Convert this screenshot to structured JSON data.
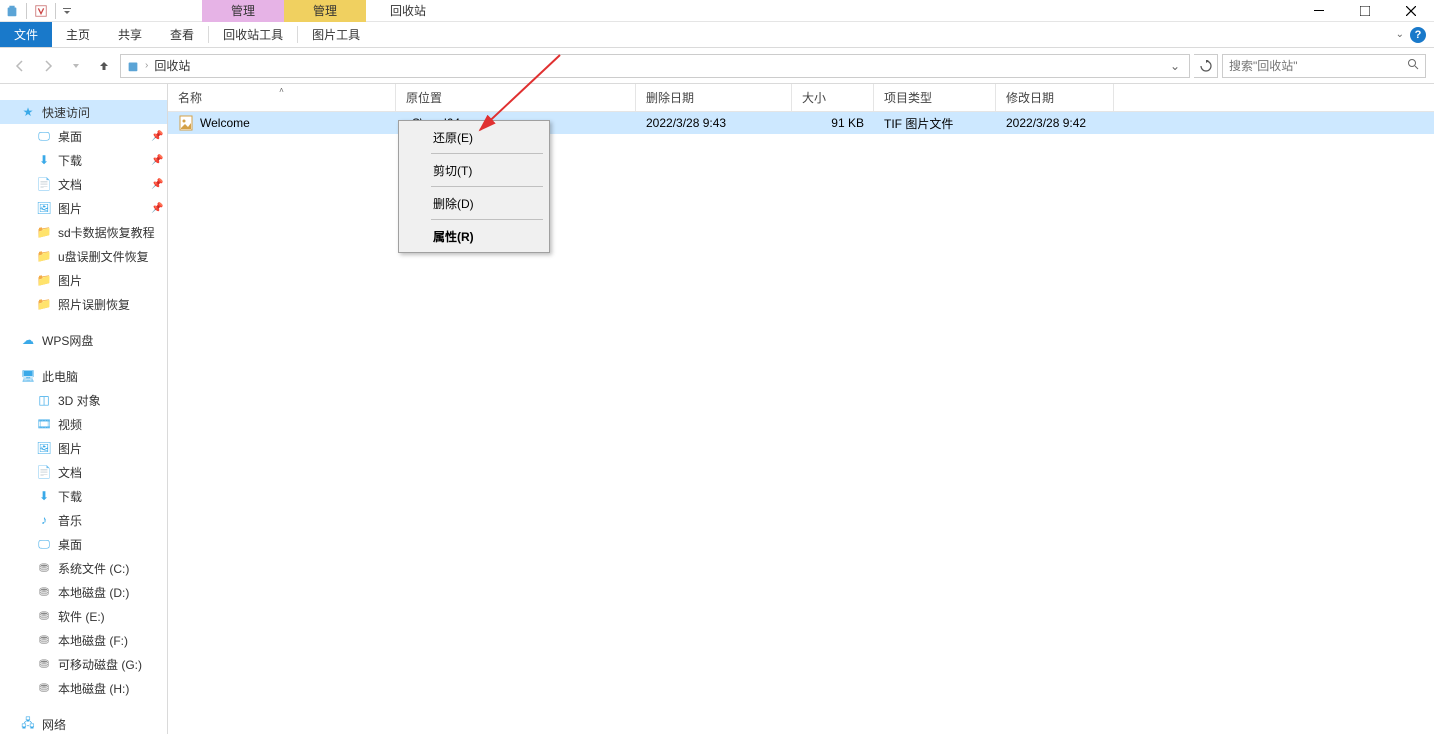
{
  "window": {
    "context_tabs": [
      "管理",
      "管理"
    ],
    "title": "回收站",
    "ribbon": {
      "file": "文件",
      "tabs": [
        "主页",
        "共享",
        "查看",
        "回收站工具",
        "图片工具"
      ]
    }
  },
  "nav": {
    "breadcrumb": [
      "回收站"
    ],
    "search_placeholder": "搜索\"回收站\""
  },
  "sidebar": {
    "quick_access": {
      "label": "快速访问",
      "items": [
        {
          "label": "桌面",
          "pinned": true,
          "icon": "desktop"
        },
        {
          "label": "下载",
          "pinned": true,
          "icon": "download"
        },
        {
          "label": "文档",
          "pinned": true,
          "icon": "document"
        },
        {
          "label": "图片",
          "pinned": true,
          "icon": "picture"
        },
        {
          "label": "sd卡数据恢复教程",
          "pinned": false,
          "icon": "folder"
        },
        {
          "label": "u盘误删文件恢复",
          "pinned": false,
          "icon": "folder"
        },
        {
          "label": "图片",
          "pinned": false,
          "icon": "folder"
        },
        {
          "label": "照片误删恢复",
          "pinned": false,
          "icon": "folder"
        }
      ]
    },
    "wps": {
      "label": "WPS网盘"
    },
    "this_pc": {
      "label": "此电脑",
      "items": [
        {
          "label": "3D 对象",
          "icon": "3d"
        },
        {
          "label": "视频",
          "icon": "video"
        },
        {
          "label": "图片",
          "icon": "picture"
        },
        {
          "label": "文档",
          "icon": "document"
        },
        {
          "label": "下载",
          "icon": "download"
        },
        {
          "label": "音乐",
          "icon": "music"
        },
        {
          "label": "桌面",
          "icon": "desktop"
        },
        {
          "label": "系统文件 (C:)",
          "icon": "drive"
        },
        {
          "label": "本地磁盘 (D:)",
          "icon": "drive"
        },
        {
          "label": "软件 (E:)",
          "icon": "drive"
        },
        {
          "label": "本地磁盘 (F:)",
          "icon": "drive"
        },
        {
          "label": "可移动磁盘 (G:)",
          "icon": "drive"
        },
        {
          "label": "本地磁盘 (H:)",
          "icon": "drive"
        }
      ]
    },
    "network": {
      "label": "网络"
    }
  },
  "columns": {
    "name": "名称",
    "original_location": "原位置",
    "date_deleted": "删除日期",
    "size": "大小",
    "item_type": "项目类型",
    "date_modified": "修改日期"
  },
  "rows": [
    {
      "name": "Welcome",
      "original_location": "xS\\amd64_...",
      "date_deleted": "2022/3/28 9:43",
      "size": "91 KB",
      "item_type": "TIF 图片文件",
      "date_modified": "2022/3/28 9:42"
    }
  ],
  "context_menu": {
    "restore": "还原(E)",
    "cut": "剪切(T)",
    "delete": "删除(D)",
    "properties": "属性(R)"
  }
}
